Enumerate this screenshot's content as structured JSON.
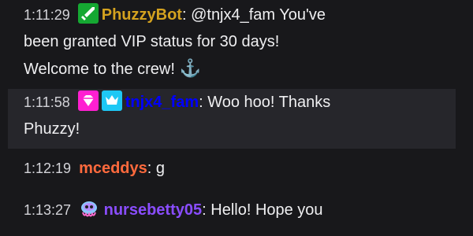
{
  "messages": [
    {
      "time": "1:11:29",
      "badges": [
        "moderator-sword-icon"
      ],
      "username": "PhuzzyBot",
      "username_color": "#d4a21f",
      "separator": ":",
      "text_line1": "@tnjx4_fam You've",
      "text_line2": "been granted VIP status for 30 days!",
      "text_line3": "Welcome to the crew!",
      "trailing_icon": "anchor-icon"
    },
    {
      "time": "1:11:58",
      "badges": [
        "vip-diamond-icon",
        "crown-icon"
      ],
      "username": "tnjx4_fam",
      "username_color": "#0000ff",
      "separator": ":",
      "text_line1": "Woo hoo! Thanks",
      "text_line2": "Phuzzy!"
    },
    {
      "time": "1:12:19",
      "username": "mceddys",
      "username_color": "#ff6a3d",
      "separator": ":",
      "text_line1": "g"
    },
    {
      "time": "1:13:27",
      "badges": [
        "jellyfish-emote-icon"
      ],
      "username": "nursebetty05",
      "username_color": "#8a4dff",
      "separator": ":",
      "text_line1": "Hello! Hope you"
    }
  ],
  "colors": {
    "background": "#18181b",
    "highlight_row": "#26262b",
    "text": "#efeff1",
    "moderator_badge": "#15a832",
    "vip_badge": "#ff1fd1",
    "crown_badge": "#1ec8f5"
  }
}
